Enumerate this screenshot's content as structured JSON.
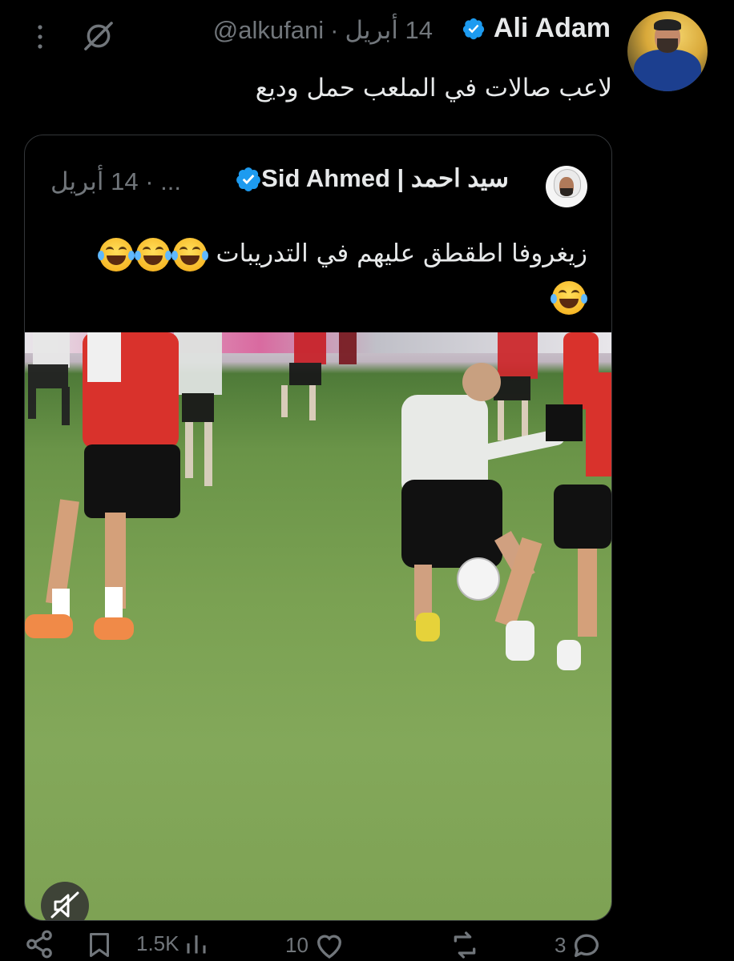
{
  "tweet": {
    "display_name": "Ali Adam",
    "handle": "@alkufani",
    "separator": "·",
    "date": "14 أبريل",
    "text": "لاعب صالات في الملعب حمل وديع"
  },
  "quote": {
    "display_name": "Sid Ahmed | سيد احمد",
    "ellipsis": "...",
    "separator": "·",
    "date": "14 أبريل",
    "text_line1": "زيغروفا اطقطق عليهم في التدريبات",
    "emoji_line1_count": 3,
    "emoji_line2_count": 1,
    "emoji_name": "face-with-tears-of-joy"
  },
  "actions": {
    "views": "1.5K",
    "likes": "10",
    "reposts": "",
    "replies": "3"
  },
  "colors": {
    "background": "#000000",
    "text": "#e7e9ea",
    "muted": "#71767b",
    "verified": "#1d9bf0",
    "border": "#333639"
  }
}
